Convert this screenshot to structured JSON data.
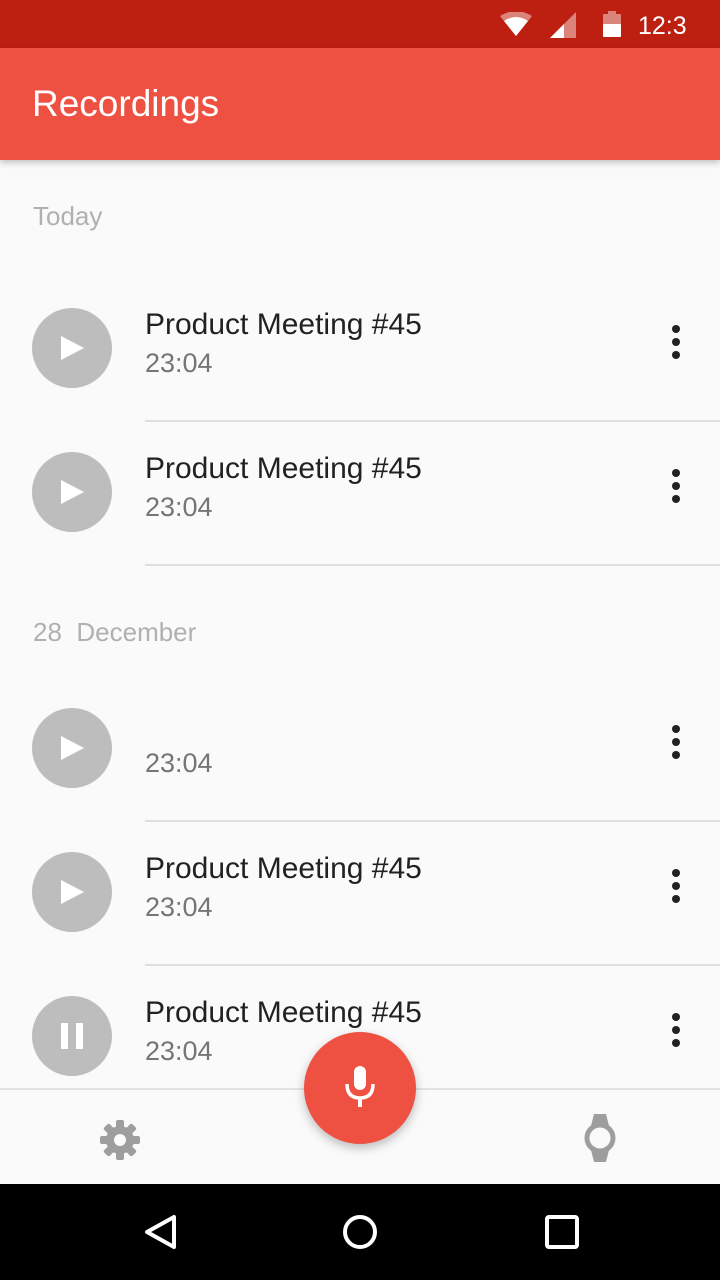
{
  "status_bar": {
    "time": "12:3",
    "icons": [
      "wifi-icon",
      "cellular-signal-icon",
      "battery-icon"
    ]
  },
  "app_bar": {
    "title": "Recordings"
  },
  "sections": [
    {
      "header": "Today",
      "items": [
        {
          "title": "Product Meeting #45",
          "time": "23:04",
          "state": "play"
        },
        {
          "title": "Product Meeting #45",
          "time": "23:04",
          "state": "play"
        }
      ]
    },
    {
      "header": "28  December",
      "items": [
        {
          "title": "",
          "time": "23:04",
          "state": "play"
        },
        {
          "title": "Product Meeting #45",
          "time": "23:04",
          "state": "play"
        },
        {
          "title": "Product Meeting #45",
          "time": "23:04",
          "state": "pause"
        }
      ]
    }
  ],
  "bottom_bar": {
    "left_icon": "settings-icon",
    "right_icon": "smartwatch-icon",
    "fab_icon": "microphone-icon"
  },
  "nav_bar": {
    "icons": [
      "back-icon",
      "home-icon",
      "recents-icon"
    ]
  },
  "colors": {
    "status_bar": "#bd1f11",
    "primary": "#ee5142",
    "avatar_gray": "#bdbdbd",
    "background": "#fafafa"
  }
}
